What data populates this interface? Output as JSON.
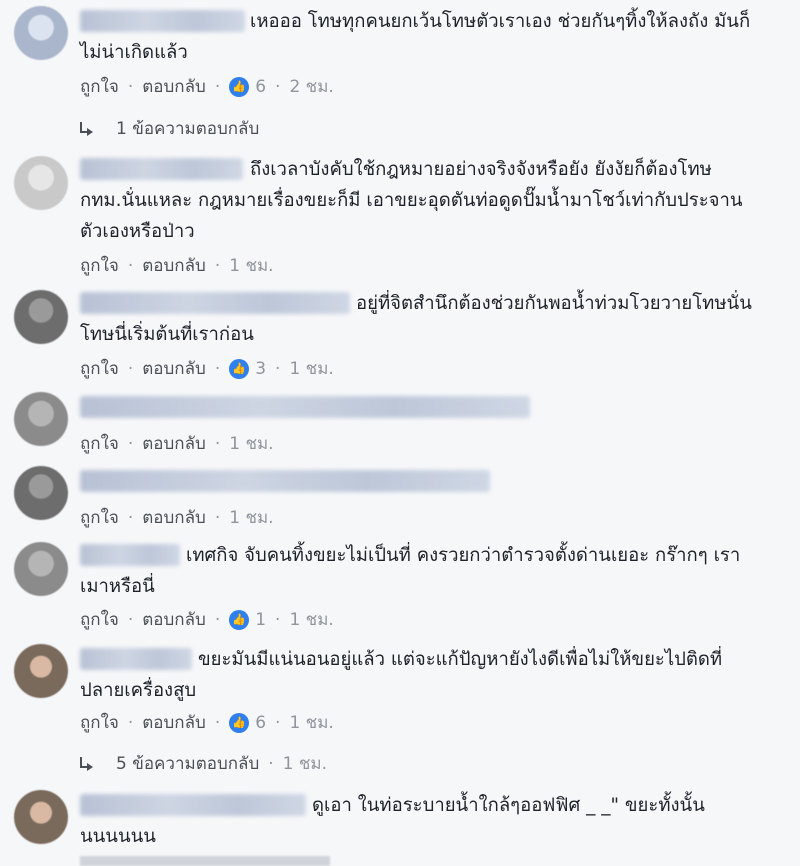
{
  "actions": {
    "like": "ถูกใจ",
    "reply": "ตอบกลับ",
    "dot": "·"
  },
  "comments": [
    {
      "text": "เหอออ โทษทุกคนยกเว้นโทษตัวเราเอง ช่วยกันๆทิ้งให้ลงถัง มันก็ไม่น่าเกิดแล้ว",
      "likes": "6",
      "time": "2 ชม.",
      "replies": "1 ข้อความตอบกลับ",
      "replies_time": ""
    },
    {
      "text": "ถึงเวลาบังคับใช้กฎหมายอย่างจริงจังหรือยัง ยังงัยก็ต้องโทษ กทม.นั่นแหละ กฎหมายเรื่องขยะก็มี เอาขยะอุดตันท่อดูดปั๊มน้ำมาโชว์เท่ากับประจานตัวเองหรือป่าว",
      "likes": "",
      "time": "1 ชม.",
      "replies": "",
      "replies_time": ""
    },
    {
      "text": "อยู่ที่จิตสำนึกต้องช่วยกันพอน้ำท่วมโวยวายโทษนั่นโทษนี่เริ่มต้นที่เราก่อน",
      "likes": "3",
      "time": "1 ชม.",
      "replies": "",
      "replies_time": ""
    },
    {
      "text": "",
      "likes": "",
      "time": "1 ชม.",
      "replies": "",
      "replies_time": ""
    },
    {
      "text": "",
      "likes": "",
      "time": "1 ชม.",
      "replies": "",
      "replies_time": ""
    },
    {
      "text": "เทศกิจ จับคนทิ้งขยะไม่เป็นที่ คงรวยกว่าตำรวจตั้งด่านเยอะ กร๊ากๆ เราเมาหรือนี่",
      "likes": "1",
      "time": "1 ชม.",
      "replies": "",
      "replies_time": ""
    },
    {
      "text": "ขยะมันมีแน่นอนอยู่แล้ว แต่จะแก้ปัญหายังไงดีเพื่อไม่ให้ขยะไปติดที่ปลายเครื่องสูบ",
      "likes": "6",
      "time": "1 ชม.",
      "replies": "5 ข้อความตอบกลับ",
      "replies_time": "1 ชม."
    },
    {
      "text": "ดูเอา ในท่อระบายน้ำใกล้ๆออฟฟิศ _ _\" ขยะทั้งนั้นนนนนนน",
      "likes": "",
      "time": "",
      "replies": "",
      "replies_time": ""
    }
  ]
}
